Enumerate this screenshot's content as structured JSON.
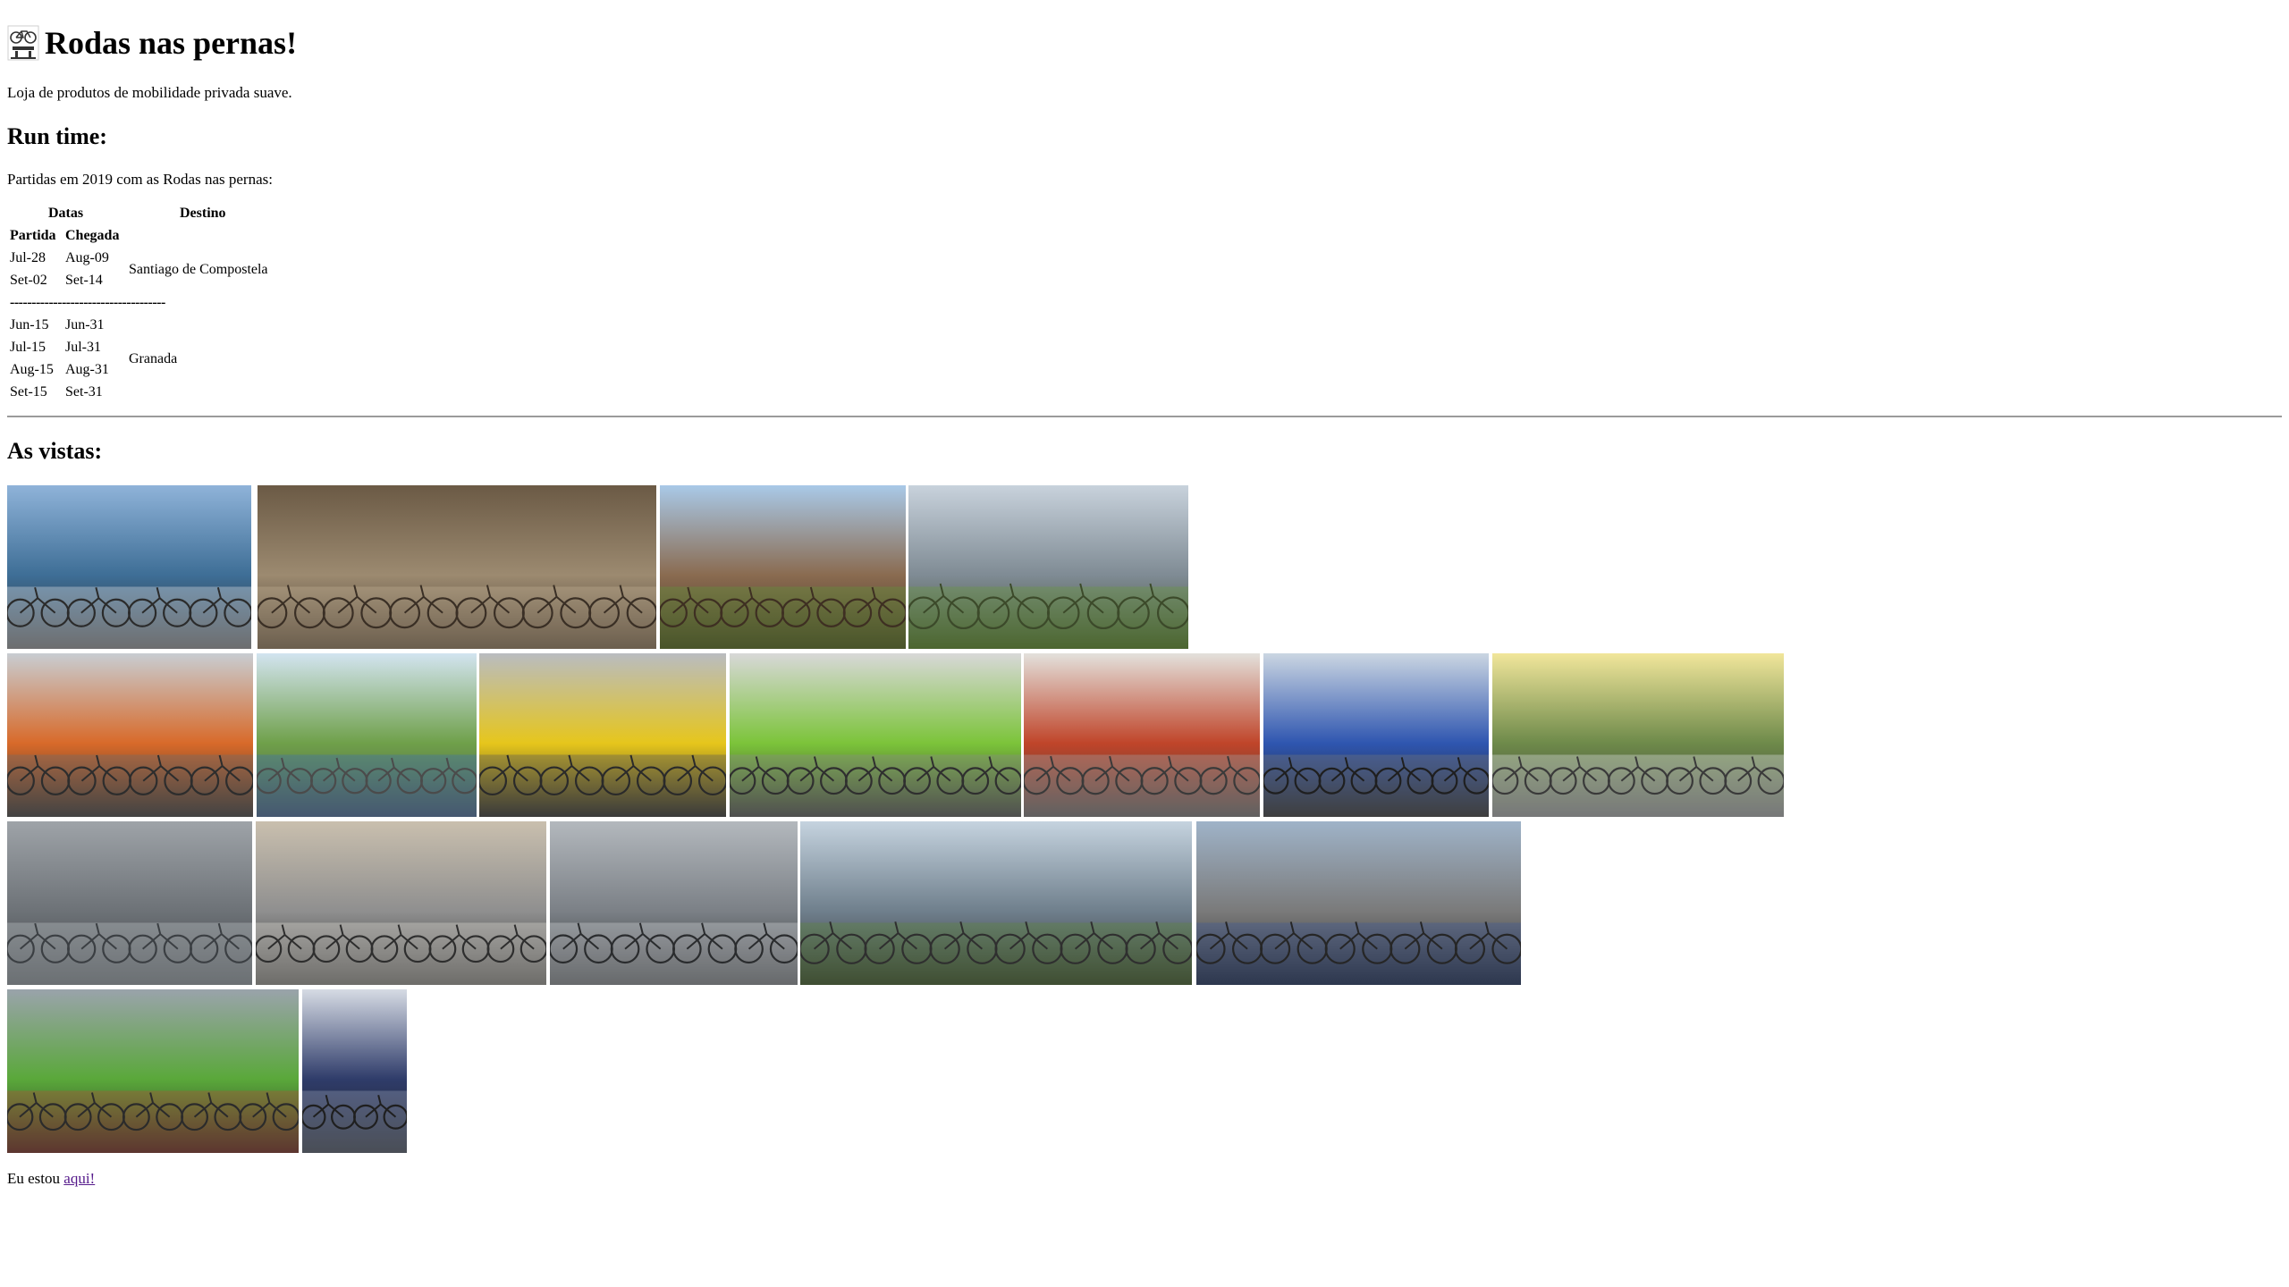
{
  "header": {
    "icon": "bicycle-icon",
    "title": "Rodas nas pernas!",
    "subtitle": "Loja de produtos de mobilidade privada suave."
  },
  "runtime": {
    "heading": "Run time:",
    "intro": "Partidas em 2019 com as Rodas nas pernas:",
    "table": {
      "col_dates": "Datas",
      "col_destination": "Destino",
      "sub_departure": "Partida",
      "sub_arrival": "Chegada",
      "separator": "------------------------------------",
      "groups": [
        {
          "destination": "Santiago de Compostela",
          "rows": [
            {
              "departure": "Jul-28",
              "arrival": "Aug-09"
            },
            {
              "departure": "Set-02",
              "arrival": "Set-14"
            }
          ]
        },
        {
          "destination": "Granada",
          "rows": [
            {
              "departure": "Jun-15",
              "arrival": "Jun-31"
            },
            {
              "departure": "Jul-15",
              "arrival": "Jul-31"
            },
            {
              "departure": "Aug-15",
              "arrival": "Aug-31"
            },
            {
              "departure": "Set-15",
              "arrival": "Set-31"
            }
          ]
        }
      ]
    }
  },
  "gallery": {
    "heading": "As vistas:",
    "photos": [
      {
        "name": "photo-coast-cyclists",
        "palette": [
          "#8fb3d9",
          "#3e6e96",
          "#e9ecef",
          "#2b2b2b"
        ]
      },
      {
        "name": "photo-desert-mtb-group",
        "palette": [
          "#6b5a45",
          "#9c8a70",
          "#c9b79a",
          "#3a2f25"
        ]
      },
      {
        "name": "photo-temple-stupa",
        "palette": [
          "#a9c9e8",
          "#8a6b50",
          "#5f9a3a",
          "#3e2f22"
        ]
      },
      {
        "name": "photo-lake-cyclists",
        "palette": [
          "#c8d2dc",
          "#7f8b94",
          "#6b9a3c",
          "#3c4a2a"
        ]
      },
      {
        "name": "photo-orange-bike-share",
        "palette": [
          "#c8cdd2",
          "#d86a2a",
          "#6e6e6e",
          "#2d2d2d"
        ]
      },
      {
        "name": "photo-blue-bikes-park",
        "palette": [
          "#d3e4f0",
          "#6fa04a",
          "#3d6fb8",
          "#4b4b4b"
        ]
      },
      {
        "name": "photo-yellow-bikes-row",
        "palette": [
          "#b9bcc0",
          "#e6c61c",
          "#5a5a5a",
          "#2a2a2a"
        ]
      },
      {
        "name": "photo-green-bike-dock",
        "palette": [
          "#d8d8d8",
          "#7cc43a",
          "#8c8c8c",
          "#2f2f2f"
        ]
      },
      {
        "name": "photo-red-bike-station",
        "palette": [
          "#e3e1dc",
          "#c0452a",
          "#a9a9a9",
          "#3a3a3a"
        ]
      },
      {
        "name": "photo-blue-bike-station",
        "palette": [
          "#cbd6e2",
          "#2f56b0",
          "#7a7a7a",
          "#1f1f1f"
        ]
      },
      {
        "name": "photo-white-bikes-field",
        "palette": [
          "#f1e69b",
          "#6e8a4a",
          "#e9ecef",
          "#3a3a3a"
        ]
      },
      {
        "name": "photo-bike-parking-aerial",
        "palette": [
          "#9ea3a8",
          "#6d7277",
          "#c7cbcf",
          "#3b3f43"
        ]
      },
      {
        "name": "photo-bike-parking-tunnel",
        "palette": [
          "#c9bfae",
          "#8f8f8f",
          "#e6e2da",
          "#2e2e2e"
        ]
      },
      {
        "name": "photo-double-deck-racks",
        "palette": [
          "#b3b8bd",
          "#7b8086",
          "#d9dcdf",
          "#2a2c2e"
        ]
      },
      {
        "name": "photo-city-street-cyclists",
        "palette": [
          "#c5d3df",
          "#6f7f8c",
          "#5f8a3a",
          "#2f2f2f"
        ]
      },
      {
        "name": "photo-commuter-crowd",
        "palette": [
          "#9fb3c8",
          "#7a7a7a",
          "#3c5a9a",
          "#262626"
        ]
      },
      {
        "name": "photo-scooters-bike-lane",
        "palette": [
          "#9aa3ab",
          "#5aa83a",
          "#b94a3a",
          "#2b2b2b"
        ]
      },
      {
        "name": "photo-business-scooter",
        "palette": [
          "#d6dbe4",
          "#2f3c6a",
          "#9aa6bd",
          "#1f1f1f"
        ]
      }
    ]
  },
  "footer": {
    "prefix": "Eu estou ",
    "link_label": "aqui!"
  }
}
